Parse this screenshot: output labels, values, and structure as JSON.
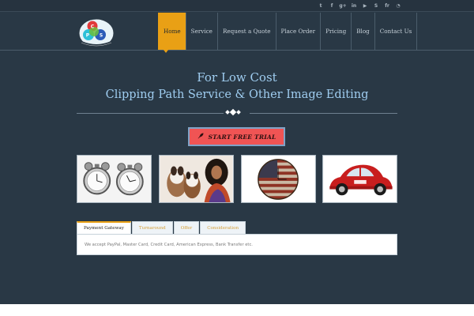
{
  "social_icons": [
    {
      "name": "twitter-icon",
      "glyph": "t"
    },
    {
      "name": "facebook-icon",
      "glyph": "f"
    },
    {
      "name": "google-plus-icon",
      "glyph": "g+"
    },
    {
      "name": "linkedin-icon",
      "glyph": "in"
    },
    {
      "name": "youtube-icon",
      "glyph": "▶"
    },
    {
      "name": "skype-icon",
      "glyph": "S"
    },
    {
      "name": "flickr-icon",
      "glyph": "fr"
    },
    {
      "name": "rss-icon",
      "glyph": "◔"
    }
  ],
  "logo": {
    "letters": [
      "C",
      "P",
      "S"
    ],
    "caption": "CLIPPING PATH SERVICE"
  },
  "nav": {
    "items": [
      "Home",
      "Service",
      "Request a Quote",
      "Place Order",
      "Pricing",
      "Blog",
      "Contact Us"
    ],
    "active_index": 0
  },
  "hero": {
    "line1": "For Low Cost",
    "line2": "Clipping Path Service & Other Image Editing"
  },
  "cta": {
    "label": "START FREE TRIAL",
    "icon": "rocket-icon"
  },
  "gallery": [
    {
      "name": "alarm-clocks-image"
    },
    {
      "name": "dogs-woman-image"
    },
    {
      "name": "flag-clock-image"
    },
    {
      "name": "red-beetle-car-image"
    }
  ],
  "tabs": {
    "labels": [
      "Payment Gateway",
      "Turnaround",
      "Offer",
      "Consideration"
    ],
    "active_index": 0,
    "content": "We accept PayPal, Master Card, Credit Card, American Express, Bank Transfer etc."
  },
  "colors": {
    "background": "#293845",
    "accent": "#e9a015",
    "hero_text": "#9fcdf0",
    "cta_bg": "#f05454"
  }
}
